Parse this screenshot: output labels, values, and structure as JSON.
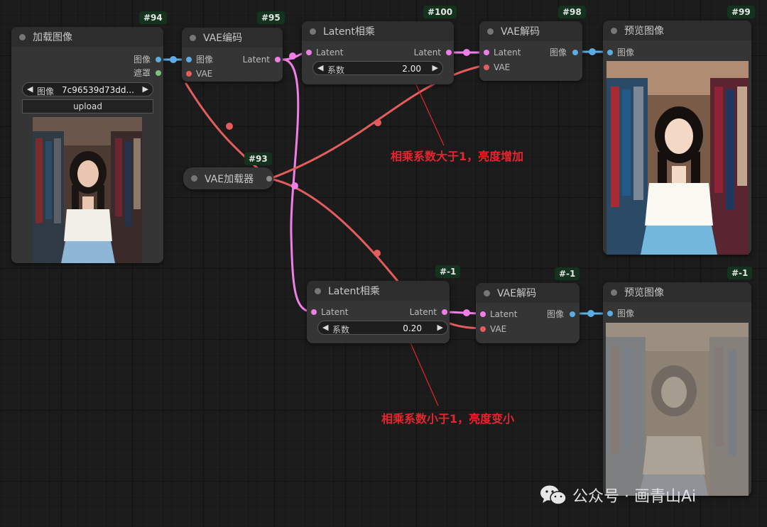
{
  "nodes": {
    "load_image": {
      "id": "#94",
      "title": "加载图像",
      "out_image": "图像",
      "out_mask": "遮罩",
      "image_label": "图像",
      "image_value": "7c96539d73dd...",
      "upload_label": "upload"
    },
    "vae_encode": {
      "id": "#95",
      "title": "VAE编码",
      "in_pixels": "图像",
      "in_vae": "VAE",
      "out_latent": "Latent"
    },
    "latent_multiply_top": {
      "id": "#100",
      "title": "Latent相乘",
      "in_latent": "Latent",
      "out_latent": "Latent",
      "factor_label": "系数",
      "factor_value": "2.00"
    },
    "vae_decode_top": {
      "id": "#98",
      "title": "VAE解码",
      "in_latent": "Latent",
      "in_vae": "VAE",
      "out_image": "图像"
    },
    "preview_top": {
      "id": "#99",
      "title": "预览图像",
      "in_image": "图像"
    },
    "vae_loader": {
      "id": "#93",
      "title": "VAE加载器"
    },
    "latent_multiply_bottom": {
      "id": "#-1",
      "title": "Latent相乘",
      "in_latent": "Latent",
      "out_latent": "Latent",
      "factor_label": "系数",
      "factor_value": "0.20"
    },
    "vae_decode_bottom": {
      "id": "#-1",
      "title": "VAE解码",
      "in_latent": "Latent",
      "in_vae": "VAE",
      "out_image": "图像"
    },
    "preview_bottom": {
      "id": "#-1",
      "title": "预览图像",
      "in_image": "图像"
    }
  },
  "annotations": {
    "top": "相乘系数大于1，亮度增加",
    "bottom": "相乘系数小于1，亮度变小"
  },
  "watermark": "公众号 · 画青山Ai",
  "colors": {
    "image_link": "#5dade2",
    "latent_link": "#ef7fe6",
    "vae_link": "#e35d5d",
    "annotation": "#e8242e",
    "badge": "#14331e"
  },
  "icons": [
    "wechat-icon",
    "arrow-left-icon",
    "arrow-right-icon"
  ]
}
